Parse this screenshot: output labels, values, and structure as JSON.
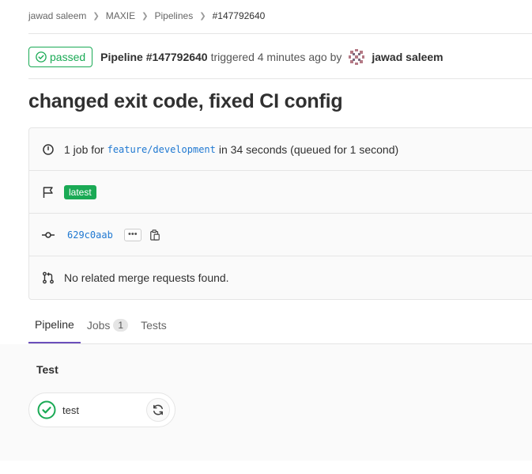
{
  "breadcrumb": {
    "items": [
      "jawad saleem",
      "MAXIE",
      "Pipelines",
      "#147792640"
    ]
  },
  "header": {
    "status": "passed",
    "pipeline_label": "Pipeline #147792640",
    "triggered_text": "triggered 4 minutes ago by",
    "author": "jawad saleem"
  },
  "title": "changed exit code, fixed CI config",
  "info": {
    "jobs_prefix": "1 job for",
    "branch": "feature/development",
    "jobs_suffix": "in 34 seconds (queued for 1 second)",
    "latest_badge": "latest",
    "commit_sha": "629c0aab",
    "ellipsis": "•••",
    "merge_requests": "No related merge requests found."
  },
  "tabs": {
    "pipeline": "Pipeline",
    "jobs": "Jobs",
    "jobs_count": "1",
    "tests": "Tests"
  },
  "graph": {
    "stage": "Test",
    "job": "test"
  },
  "colors": {
    "success": "#1aaa55",
    "link": "#1f78d1",
    "tab_active": "#6b4fbb"
  },
  "icons": [
    "chevron-right-icon",
    "check-circle-icon",
    "clock-icon",
    "flag-icon",
    "commit-icon",
    "clipboard-icon",
    "merge-request-icon",
    "retry-icon"
  ]
}
